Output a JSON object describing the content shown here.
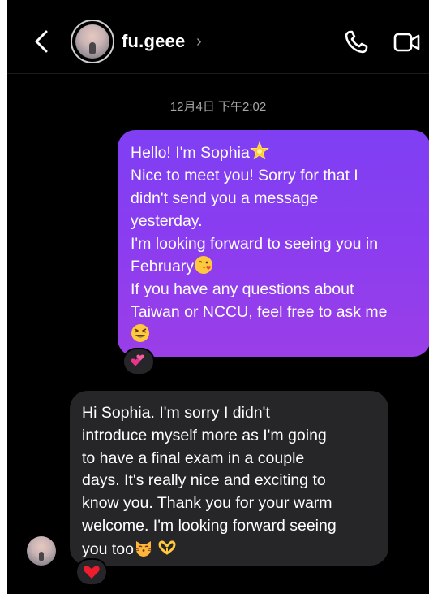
{
  "header": {
    "username": "fu.geee",
    "username_chevron": "›",
    "back_icon": "chevron-left-icon",
    "call_icon": "phone-icon",
    "video_icon": "video-camera-icon"
  },
  "timestamp": "12月4日 下午2:02",
  "messages": {
    "outgoing": {
      "lines": [
        "Hello! I'm Sophia",
        "Nice to meet you! Sorry for that I",
        "didn't send you a message",
        "yesterday.",
        "I'm looking forward to seeing you in",
        "February",
        "If you have any questions about",
        "Taiwan or NCCU, feel free to ask me"
      ],
      "emojis": [
        "glowing-star",
        "kissing-face",
        "grinning-squinting-face"
      ],
      "reaction": "two-hearts"
    },
    "incoming": {
      "lines": [
        "Hi Sophia. I'm sorry I didn't",
        "introduce myself more as I'm going",
        "to have a final exam in a couple",
        "days. It's really nice and exciting to",
        "know you. Thank you for your warm",
        "welcome. I'm looking forward seeing",
        "you too"
      ],
      "emojis": [
        "kissing-cat",
        "heart-hands"
      ],
      "reaction": "red-heart"
    }
  },
  "colors": {
    "background": "#000000",
    "outgoing_bubble": "#8a3df0",
    "incoming_bubble": "#262628",
    "timestamp_text": "#a7a7a7"
  }
}
